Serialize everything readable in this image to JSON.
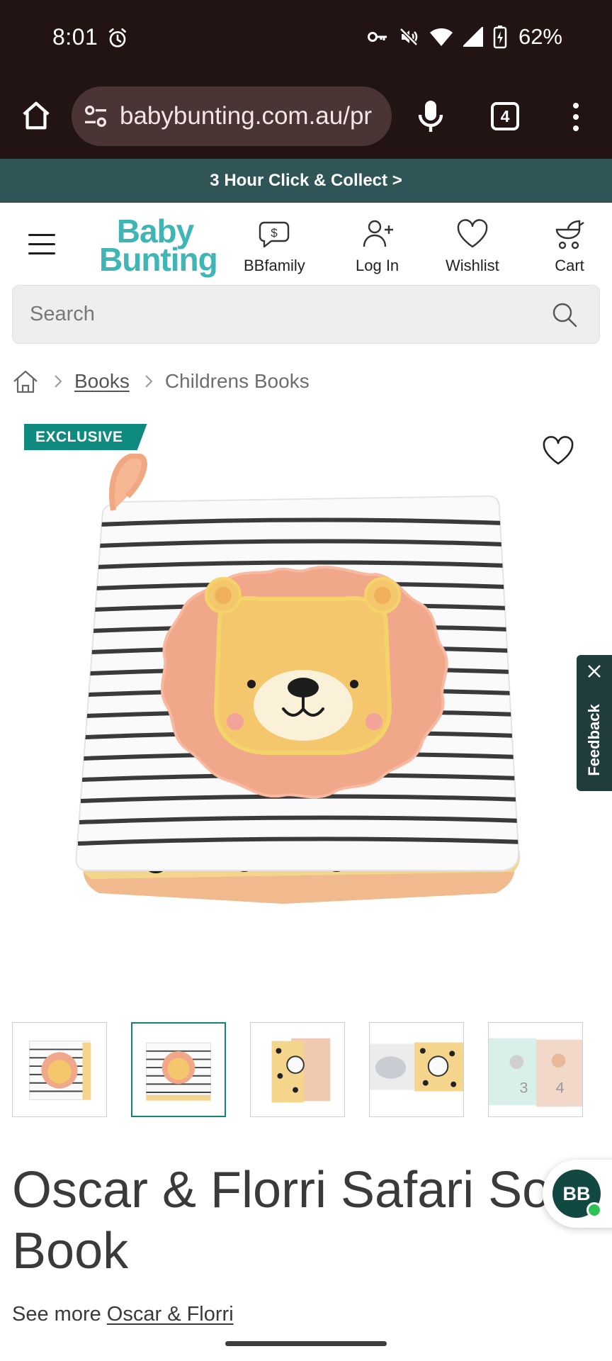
{
  "status_bar": {
    "time": "8:01",
    "battery": "62%"
  },
  "browser": {
    "url": "babybunting.com.au/pr",
    "tab_count": "4"
  },
  "promo": {
    "text": "3 Hour Click & Collect >"
  },
  "header": {
    "logo_line1": "Baby",
    "logo_line2": "Bunting",
    "nav": [
      {
        "label": "BBfamily",
        "icon": "bbfamily-icon"
      },
      {
        "label": "Log In",
        "icon": "user-add-icon"
      },
      {
        "label": "Wishlist",
        "icon": "heart-icon"
      },
      {
        "label": "Cart",
        "icon": "pram-cart-icon"
      }
    ]
  },
  "search": {
    "placeholder": "Search"
  },
  "breadcrumb": {
    "items": [
      "Books",
      "Childrens Books"
    ]
  },
  "product": {
    "badge": "EXCLUSIVE",
    "title": "Oscar & Florri Safari Soft Book",
    "see_more_prefix": "See more",
    "brand": "Oscar & Florri"
  },
  "feedback": {
    "label": "Feedback"
  },
  "chat": {
    "initials": "BB"
  },
  "colors": {
    "browser_bg": "#231414",
    "promo_bg": "#2f5556",
    "brand_teal": "#3fb6b5",
    "badge_green": "#0f8a7e"
  }
}
